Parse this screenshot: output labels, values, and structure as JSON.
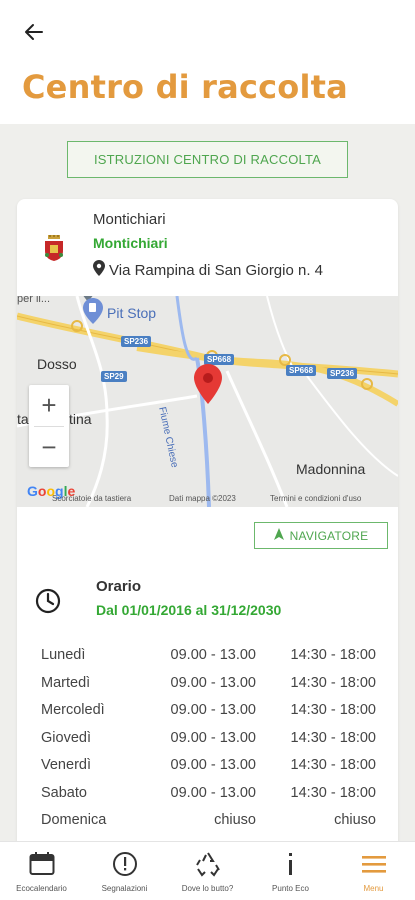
{
  "header": {
    "title": "Centro di raccolta",
    "back_icon": "arrow-left-icon"
  },
  "instructions_button": "ISTRUZIONI CENTRO DI RACCOLTA",
  "location": {
    "name": "Montichiari",
    "municipality": "Montichiari",
    "address": "Via Rampina di San Giorgio n. 4"
  },
  "map": {
    "labels": {
      "top_left": "per il...",
      "pit_stop": "Pit Stop",
      "dosso": "Dosso",
      "tina": "tagliatina",
      "madonnina": "Madonnina",
      "fiume": "Fiume Chiese"
    },
    "shields": [
      "SP236",
      "SP668",
      "SP29",
      "SP668",
      "SP236"
    ],
    "attribution": {
      "google": "Google",
      "shortcuts": "Scorciatoie da tastiera",
      "data": "Dati mappa ©2023",
      "terms": "Termini e condizioni d'uso"
    },
    "zoom_in": "+",
    "zoom_out": "−"
  },
  "navigator_button": "NAVIGATORE",
  "schedule": {
    "label": "Orario",
    "range": "Dal 01/01/2016 al 31/12/2030",
    "rows": [
      {
        "day": "Lunedì",
        "morning": "09.00 - 13.00",
        "afternoon": "14:30 - 18:00"
      },
      {
        "day": "Martedì",
        "morning": "09.00 - 13.00",
        "afternoon": "14:30 - 18:00"
      },
      {
        "day": "Mercoledì",
        "morning": "09.00 - 13.00",
        "afternoon": "14:30 - 18:00"
      },
      {
        "day": "Giovedì",
        "morning": "09.00 - 13.00",
        "afternoon": "14:30 - 18:00"
      },
      {
        "day": "Venerdì",
        "morning": "09.00 - 13.00",
        "afternoon": "14:30 - 18:00"
      },
      {
        "day": "Sabato",
        "morning": "09.00 - 13.00",
        "afternoon": "14:30 - 18:00"
      },
      {
        "day": "Domenica",
        "morning": "chiuso",
        "afternoon": "chiuso"
      }
    ]
  },
  "tabs": [
    {
      "label": "Ecocalendario",
      "icon": "calendar-icon"
    },
    {
      "label": "Segnalazioni",
      "icon": "alert-icon"
    },
    {
      "label": "Dove lo butto?",
      "icon": "recycle-icon"
    },
    {
      "label": "Punto Eco",
      "icon": "info-icon"
    },
    {
      "label": "Menu",
      "icon": "menu-icon"
    }
  ],
  "colors": {
    "accent": "#e39a3e",
    "green": "#34a834",
    "button_border": "#6cb86c"
  }
}
